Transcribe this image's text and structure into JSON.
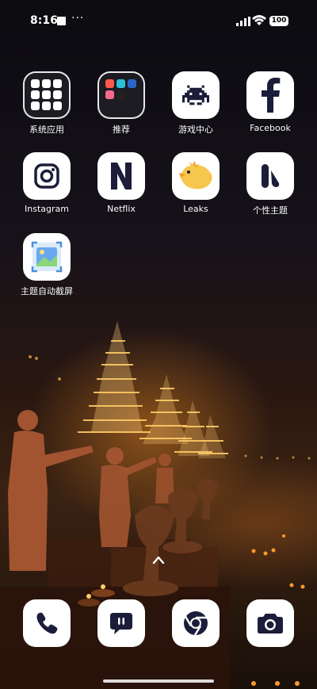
{
  "status_bar": {
    "time": "8:16",
    "extra_indicator": "···",
    "battery_level": "100"
  },
  "apps": [
    {
      "id": "system-apps",
      "label": "系统应用",
      "icon": "folder-icon"
    },
    {
      "id": "recommended",
      "label": "推荐",
      "icon": "folder-icon"
    },
    {
      "id": "game-center",
      "label": "游戏中心",
      "icon": "space-invader-icon"
    },
    {
      "id": "facebook",
      "label": "Facebook",
      "icon": "facebook-icon"
    },
    {
      "id": "instagram",
      "label": "Instagram",
      "icon": "instagram-icon"
    },
    {
      "id": "netflix",
      "label": "Netflix",
      "icon": "netflix-icon"
    },
    {
      "id": "leaks",
      "label": "Leaks",
      "icon": "bird-icon"
    },
    {
      "id": "themes",
      "label": "个性主题",
      "icon": "theme-icon"
    },
    {
      "id": "theme-auto-screenshot",
      "label": "主题自动截屏",
      "icon": "gallery-icon"
    }
  ],
  "dock": [
    {
      "id": "phone",
      "icon": "phone-icon"
    },
    {
      "id": "messages",
      "icon": "message-icon"
    },
    {
      "id": "chrome",
      "icon": "chrome-icon"
    },
    {
      "id": "camera",
      "icon": "camera-icon"
    }
  ],
  "colors": {
    "accent_dark": "#1b1d3a",
    "tile_bg": "#ffffff",
    "lamp_orange": "#ffb347"
  }
}
